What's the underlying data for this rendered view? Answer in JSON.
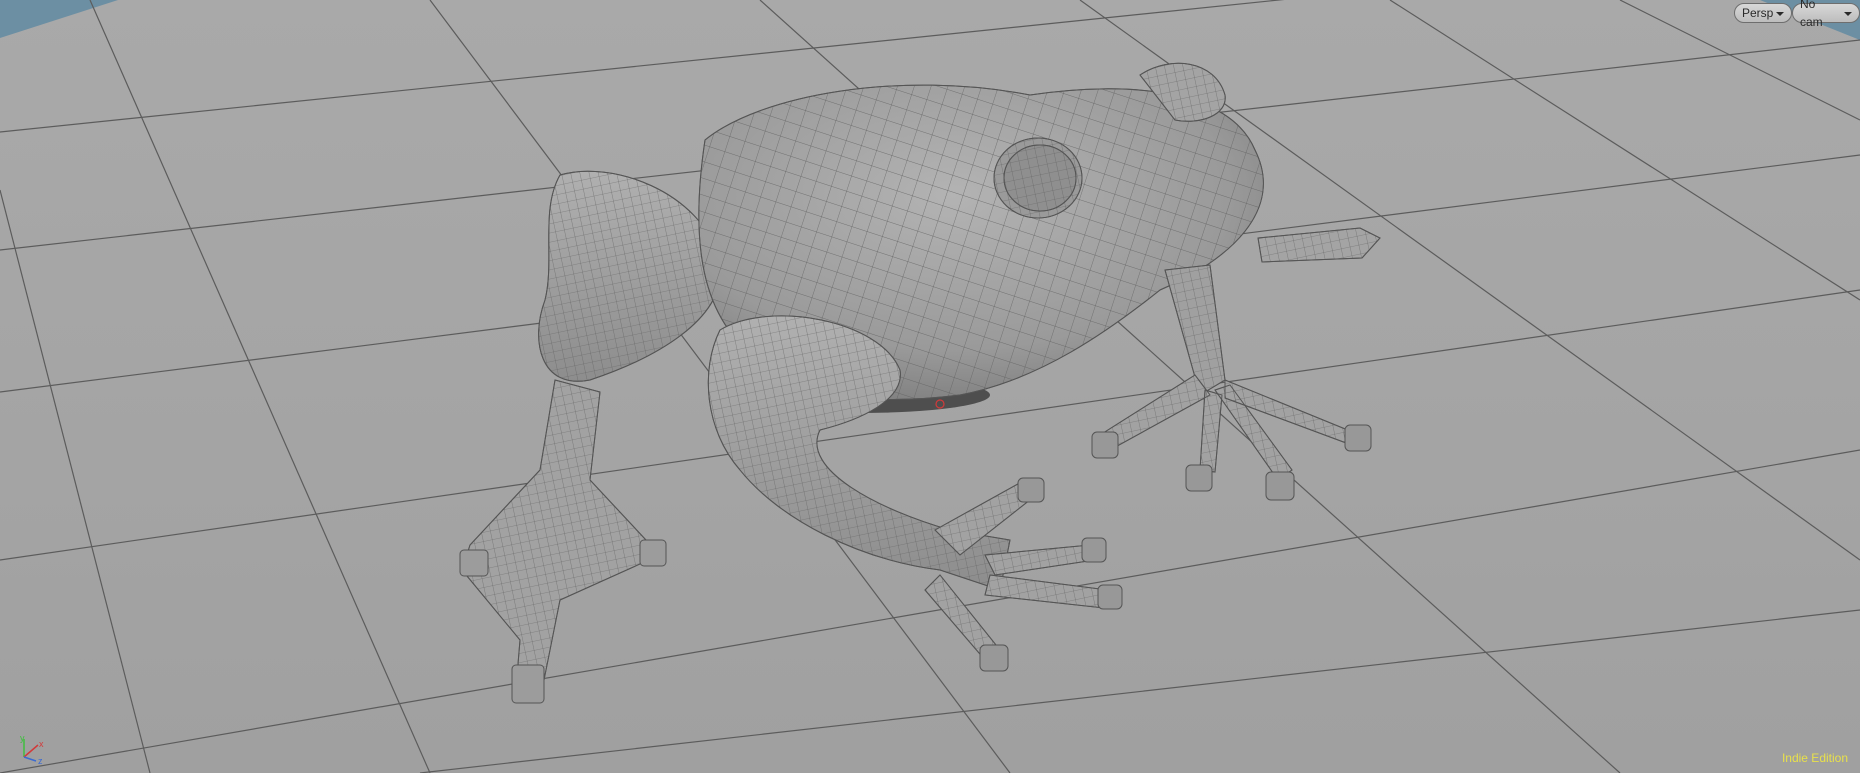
{
  "viewport": {
    "camera_menu": {
      "label": "Persp"
    },
    "camera_select": {
      "label": "No cam"
    },
    "edition": "Indie Edition",
    "axis": {
      "x": "x",
      "y": "y",
      "z": "z"
    }
  },
  "colors": {
    "background": "#a6a6a6",
    "grid_line": "#595959",
    "mesh_fill": "#9b9b9b",
    "mesh_wire": "#5a5a5a",
    "edition_text": "#e8e04a",
    "axis_x": "#d23a3a",
    "axis_y": "#3fbf3f",
    "axis_z": "#3a6ad2",
    "backdrop_blue": "#6c8fa3"
  },
  "scene": {
    "object": "frog-mesh",
    "display": "wireframe-on-shaded"
  }
}
